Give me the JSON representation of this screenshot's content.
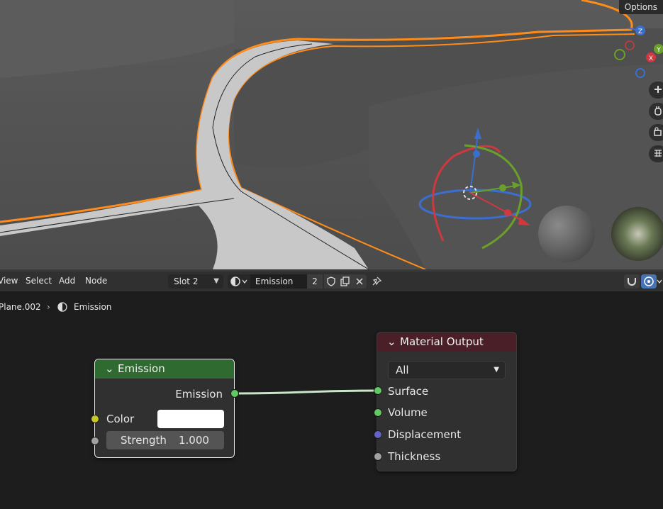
{
  "viewport": {
    "options_label": "Options"
  },
  "header": {
    "menus": [
      "View",
      "Select",
      "Add",
      "Node"
    ],
    "slot": "Slot 2",
    "material_name": "Emission",
    "material_users": "2"
  },
  "breadcrumb": {
    "object": "Plane.002",
    "material": "Emission"
  },
  "nodes": {
    "emission": {
      "title": "Emission",
      "output_label": "Emission",
      "color_label": "Color",
      "color_value": "#ffffff",
      "strength_label": "Strength",
      "strength_value": "1.000"
    },
    "material_output": {
      "title": "Material Output",
      "target": "All",
      "inputs": [
        "Surface",
        "Volume",
        "Displacement",
        "Thickness"
      ]
    }
  },
  "colors": {
    "emission_header": "#2f6a30",
    "output_header": "#4a1f28",
    "socket_shader": "#63c763",
    "socket_color": "#c7c729",
    "socket_float": "#a1a1a1",
    "socket_vector": "#6363c7",
    "selection": "#ff8c1a"
  }
}
